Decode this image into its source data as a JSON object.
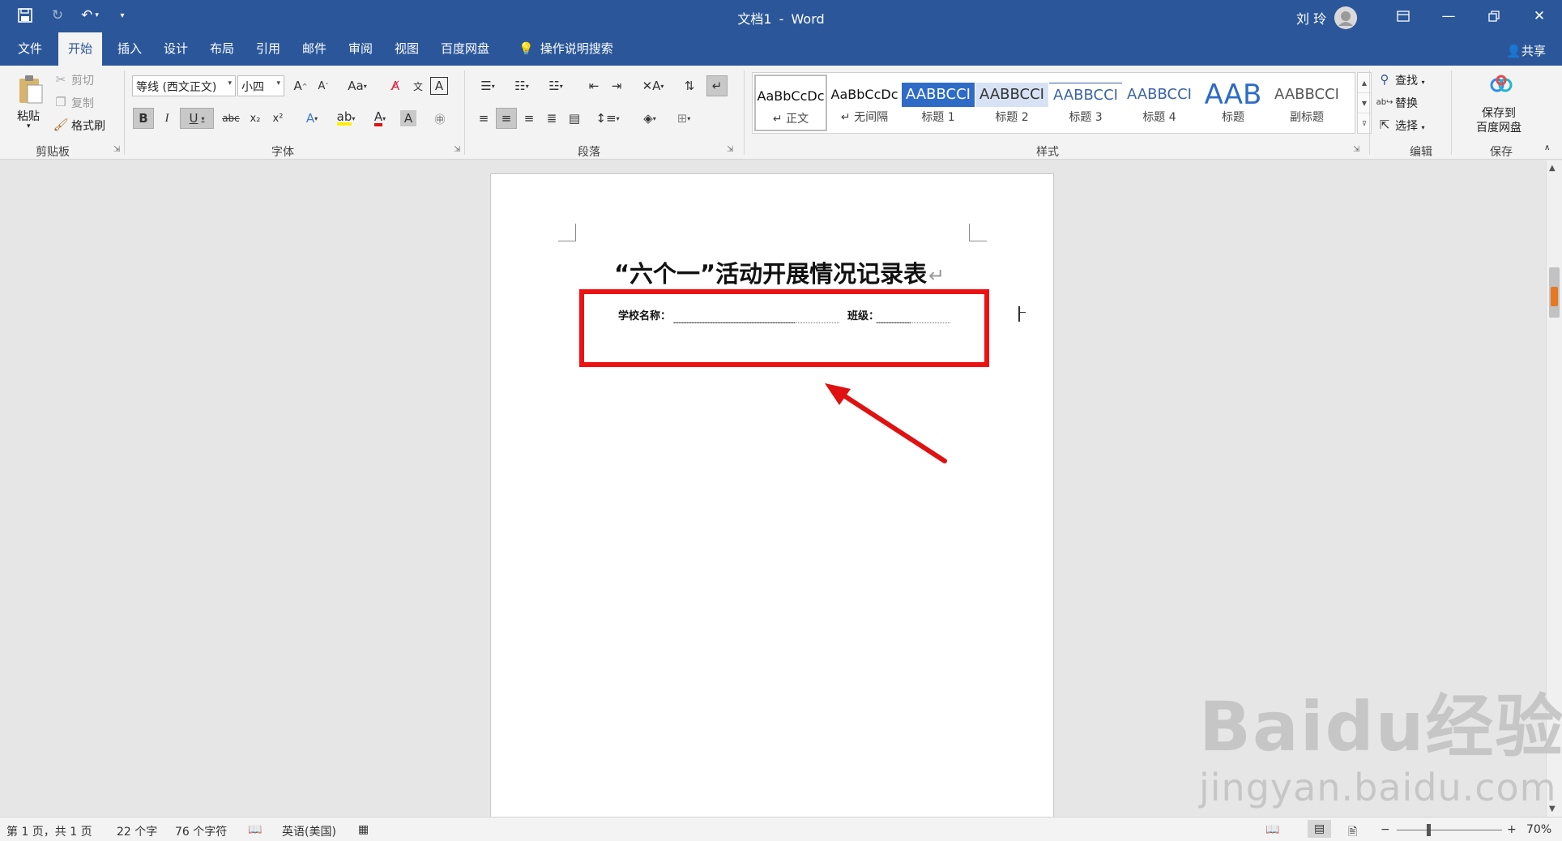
{
  "title_bar": {
    "doc_name": "文档1",
    "separator": "-",
    "app_name": "Word",
    "user_name": "刘 玲",
    "icons": [
      "save-icon",
      "redo-icon",
      "undo-icon",
      "customize-qat-icon",
      "ribbon-display-icon",
      "minimize-icon",
      "restore-icon",
      "close-icon"
    ]
  },
  "tabs": [
    {
      "label": "文件"
    },
    {
      "label": "开始",
      "active": true
    },
    {
      "label": "插入"
    },
    {
      "label": "设计"
    },
    {
      "label": "布局"
    },
    {
      "label": "引用"
    },
    {
      "label": "邮件"
    },
    {
      "label": "审阅"
    },
    {
      "label": "视图"
    },
    {
      "label": "百度网盘"
    }
  ],
  "tell_me": "操作说明搜索",
  "share": "共享",
  "clipboard": {
    "paste": "粘贴",
    "cut": "剪切",
    "copy": "复制",
    "format_painter": "格式刷",
    "group": "剪贴板"
  },
  "font": {
    "name": "等线 (西文正文)",
    "size": "小四",
    "change_case": "Aa",
    "bold": "B",
    "italic": "I",
    "underline": "U",
    "strikethrough": "abc",
    "subscript": "x₂",
    "superscript": "x²",
    "font_color_letter": "A",
    "group": "字体"
  },
  "paragraph": {
    "group": "段落"
  },
  "styles": {
    "items": [
      {
        "sample": "AaBbCcDc",
        "name": "正文"
      },
      {
        "sample": "AaBbCcDc",
        "name": "无间隔"
      },
      {
        "sample": "AABBCCI",
        "name": "标题 1"
      },
      {
        "sample": "AABBCCI",
        "name": "标题 2"
      },
      {
        "sample": "AABBCCI",
        "name": "标题 3"
      },
      {
        "sample": "AABBCCI",
        "name": "标题 4"
      },
      {
        "sample": "AAB",
        "name": "标题"
      },
      {
        "sample": "AABBCCI",
        "name": "副标题"
      }
    ],
    "group": "样式"
  },
  "editing": {
    "find": "查找",
    "replace": "替换",
    "select": "选择",
    "group": "编辑"
  },
  "save": {
    "button": "保存到",
    "button_line2": "百度网盘",
    "group": "保存"
  },
  "document": {
    "heading": "“六个一”活动开展情况记录表",
    "para_mark": "↵",
    "school_label": "学校名称：",
    "class_label": "班级："
  },
  "status_bar": {
    "page": "第 1 页，共 1 页",
    "words": "22 个字",
    "chars": "76 个字符",
    "language": "英语(美国)",
    "zoom": "70%"
  },
  "watermark": {
    "main": "Baidu经验",
    "sub": "jingyan.baidu.com"
  },
  "colors": {
    "accent": "#2b579a",
    "highlight_box": "#ee1111",
    "annotation_arrow": "#e01111"
  }
}
